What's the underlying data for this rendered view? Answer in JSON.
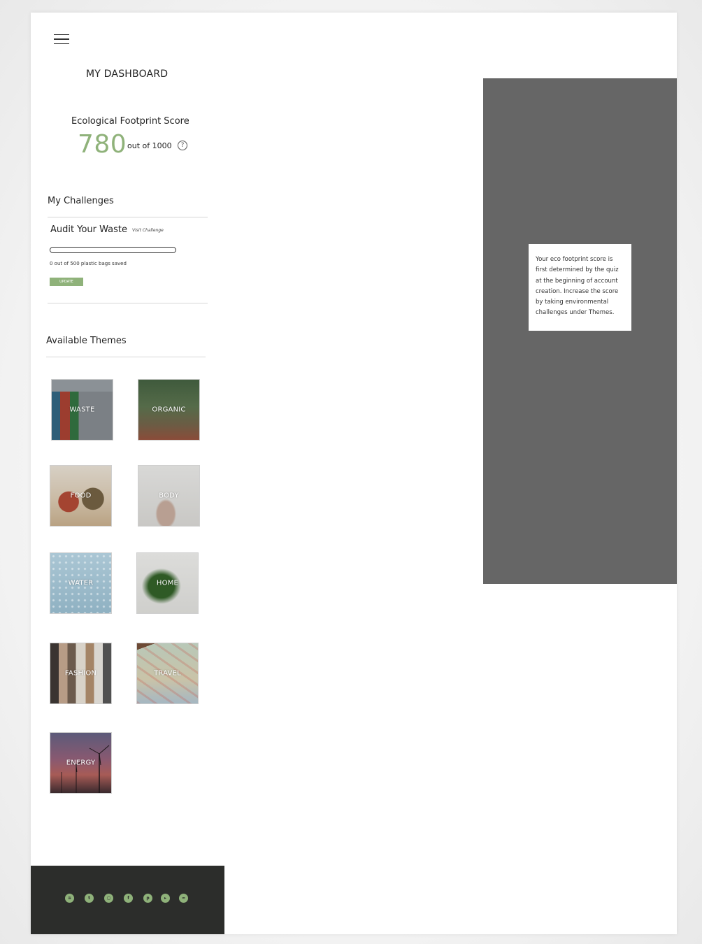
{
  "header": {
    "title": "MY DASHBOARD"
  },
  "score": {
    "label": "Ecological Footprint Score",
    "value": "780",
    "out_of": "out of 1000",
    "help_symbol": "?"
  },
  "challenges": {
    "heading": "My Challenges",
    "items": [
      {
        "title": "Audit Your Waste",
        "link": "Visit Challenge",
        "status": "0 out of 500 plastic bags saved",
        "progress": 0,
        "button": "UPDATE"
      }
    ]
  },
  "themes": {
    "heading": "Available Themes",
    "items": [
      {
        "label": "WASTE"
      },
      {
        "label": "ORGANIC"
      },
      {
        "label": "FOOD"
      },
      {
        "label": "BODY"
      },
      {
        "label": "WATER"
      },
      {
        "label": "HOME"
      },
      {
        "label": "FASHION"
      },
      {
        "label": "TRAVEL"
      },
      {
        "label": "ENERGY"
      }
    ]
  },
  "footer": {
    "social_icons": [
      "spotify-icon",
      "twitter-icon",
      "instagram-icon",
      "facebook-icon",
      "pinterest-icon",
      "youtube-icon",
      "rss-icon"
    ]
  },
  "tooltip": {
    "text": "Your eco footprint score is first determined by the quiz at the beginning of account creation. Increase the score by taking environmental challenges under Themes."
  },
  "colors": {
    "accent": "#8fb27a",
    "footer_bg": "#2c2d2b",
    "overlay_panel": "#666666"
  }
}
